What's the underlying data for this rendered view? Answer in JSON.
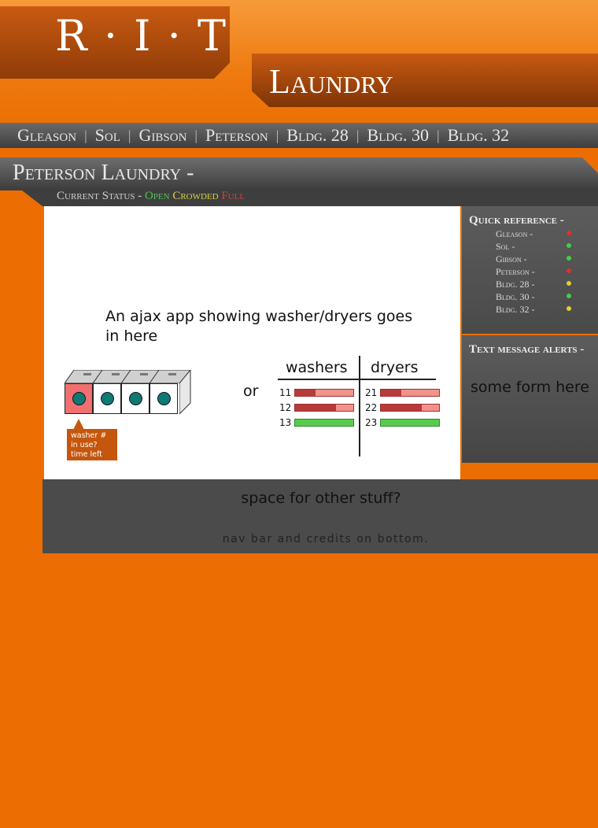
{
  "logo": {
    "text": "R · I · T"
  },
  "header": {
    "title": "Laundry"
  },
  "nav": {
    "items": [
      "Gleason",
      "Sol",
      "Gibson",
      "Peterson",
      "Bldg. 28",
      "Bldg. 30",
      "Bldg. 32"
    ],
    "separator": "|"
  },
  "page": {
    "title": "Peterson  Laundry -",
    "status_label": "Current Status - ",
    "status_open": "Open",
    "status_crowded": "Crowded",
    "status_full": "Full"
  },
  "main": {
    "note": "An ajax app showing washer/dryers goes in here",
    "or_text": "or",
    "tooltip": [
      "washer #",
      "in use?",
      "time left"
    ],
    "machines": [
      {
        "in_use": true
      },
      {
        "in_use": false
      },
      {
        "in_use": false
      },
      {
        "in_use": false
      }
    ],
    "table": {
      "washers_header": "washers",
      "dryers_header": "dryers",
      "washers": [
        {
          "number": "11",
          "used_fraction": 0.35
        },
        {
          "number": "12",
          "used_fraction": 0.7
        },
        {
          "number": "13",
          "used_fraction": 0
        }
      ],
      "dryers": [
        {
          "number": "21",
          "used_fraction": 0.35
        },
        {
          "number": "22",
          "used_fraction": 0.7
        },
        {
          "number": "23",
          "used_fraction": 0
        }
      ]
    }
  },
  "quick_reference": {
    "title": "Quick reference -",
    "items": [
      {
        "name": "Gleason -",
        "status_color": "#e03030"
      },
      {
        "name": "Sol -",
        "status_color": "#40d040"
      },
      {
        "name": "Gibson -",
        "status_color": "#40d040"
      },
      {
        "name": "Peterson -",
        "status_color": "#e03030"
      },
      {
        "name": "Bldg. 28 -",
        "status_color": "#e0d030"
      },
      {
        "name": "Bldg. 30 -",
        "status_color": "#40d040"
      },
      {
        "name": "Bldg. 32 -",
        "status_color": "#e0d030"
      }
    ]
  },
  "alerts": {
    "title": "Text message alerts -",
    "form_note": "some form here"
  },
  "bottom": {
    "other_stuff": "space for other stuff?",
    "credits": "nav bar and credits on bottom."
  },
  "colors": {
    "orange": "#ec6e02",
    "dark_panel": "#4b4b4b",
    "open": "#50c050",
    "crowded": "#d8d040",
    "full": "#d04040"
  }
}
